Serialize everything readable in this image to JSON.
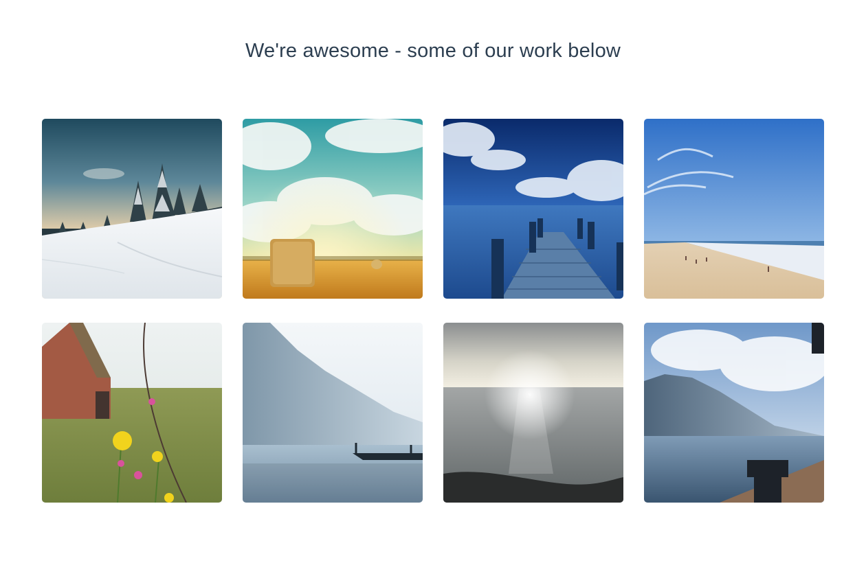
{
  "heading": "We're awesome - some of our work below",
  "gallery": {
    "items": [
      {
        "id": "snowy-forest",
        "subject": "snowy-forest-image"
      },
      {
        "id": "hay-bale-clouds",
        "subject": "hay-bale-field-image"
      },
      {
        "id": "wooden-pier",
        "subject": "wooden-pier-sea-image"
      },
      {
        "id": "beach",
        "subject": "beach-shoreline-image"
      },
      {
        "id": "wildflowers-barn",
        "subject": "wildflowers-barn-image"
      },
      {
        "id": "misty-lake-boat",
        "subject": "misty-lake-boat-image"
      },
      {
        "id": "sunlit-sea",
        "subject": "sunlit-sea-image"
      },
      {
        "id": "lake-dock-mountains",
        "subject": "lake-dock-mountains-image"
      }
    ]
  }
}
